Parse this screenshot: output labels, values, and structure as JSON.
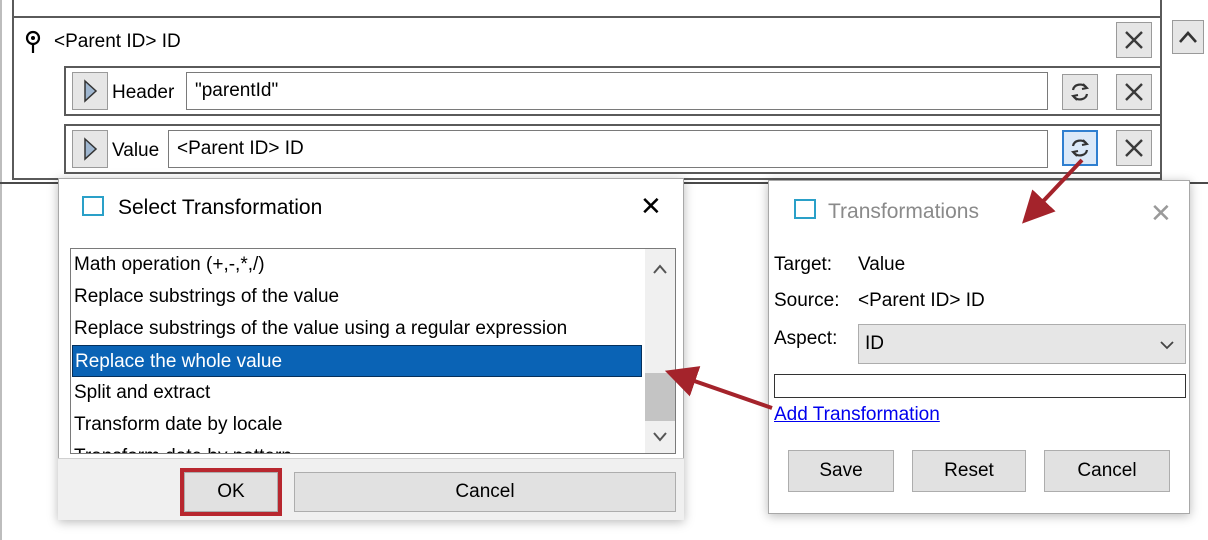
{
  "icons": {
    "pin": "pin-icon",
    "close": "close-icon",
    "collapse": "chevron-up-icon",
    "expand": "play-triangle-icon",
    "transform": "transform-arrows-icon",
    "window": "window-icon",
    "scroll_up": "scroll-up-arrow-icon",
    "scroll_down": "scroll-down-arrow-icon",
    "dropdown": "chevron-down-icon"
  },
  "colors": {
    "selection": "#0a63b5",
    "highlight": "#b8272f",
    "link": "#0000ee",
    "dialog_icon": "#2aa0c8"
  },
  "mapping": {
    "parent_title": "<Parent ID> ID",
    "header": {
      "label": "Header",
      "value": "\"parentId\""
    },
    "value": {
      "label": "Value",
      "value": "<Parent ID> ID"
    }
  },
  "select_transformation": {
    "title": "Select Transformation",
    "items": [
      "Math operation (+,-,*,/)",
      "Replace substrings of the value",
      "Replace substrings of the value using a regular expression",
      "Replace the whole value",
      "Split and extract",
      "Transform date by locale",
      "Transform date by pattern"
    ],
    "selected_index": 3,
    "ok_label": "OK",
    "cancel_label": "Cancel"
  },
  "transformations": {
    "title": "Transformations",
    "target_label": "Target:",
    "target_value": "Value",
    "source_label": "Source:",
    "source_value": "<Parent ID> ID",
    "aspect_label": "Aspect:",
    "aspect_value": "ID",
    "add_link": "Add Transformation",
    "save_label": "Save",
    "reset_label": "Reset",
    "cancel_label": "Cancel"
  }
}
